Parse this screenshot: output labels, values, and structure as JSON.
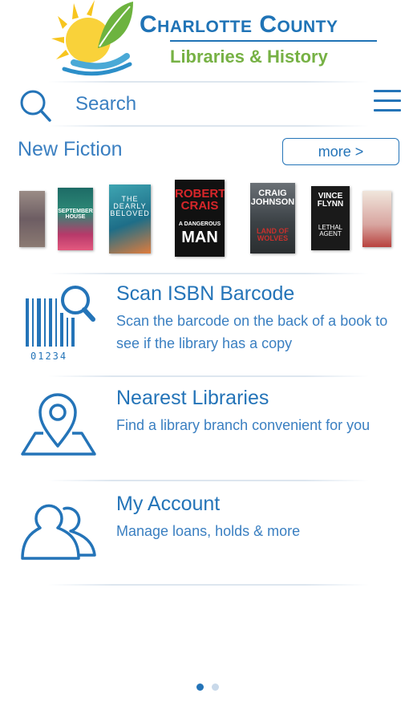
{
  "brand": {
    "title": "Charlotte County",
    "subtitle": "Libraries & History",
    "colors": {
      "blue": "#1f73b6",
      "green": "#76b144",
      "sun": "#f7c51e"
    }
  },
  "search": {
    "placeholder": "Search",
    "icon": "search-icon"
  },
  "menu": {
    "icon": "hamburger-menu-icon"
  },
  "new_fiction": {
    "title": "New Fiction",
    "more_label": "more >",
    "covers": [
      {
        "name": "book-cover-1",
        "text": ""
      },
      {
        "name": "book-cover-2",
        "text": "THE SEPTEMBER HOUSE"
      },
      {
        "name": "book-cover-3",
        "text": "THE DEARLY BELOVED"
      },
      {
        "name": "book-cover-4",
        "text": "ROBERT CRAIS A DANGEROUS MAN"
      },
      {
        "name": "book-cover-5",
        "text": "CRAIG JOHNSON LAND OF WOLVES"
      },
      {
        "name": "book-cover-6",
        "text": "VINCE FLYNN LETHAL AGENT"
      },
      {
        "name": "book-cover-7",
        "text": ""
      }
    ]
  },
  "features": [
    {
      "title": "Scan ISBN Barcode",
      "desc": "Scan the barcode on the back of a book to see if the library has a copy",
      "icon": "barcode-scan-icon",
      "barcode_digits": "01234"
    },
    {
      "title": "Nearest Libraries",
      "desc": "Find a library branch convenient for you",
      "icon": "map-pin-icon"
    },
    {
      "title": "My Account",
      "desc": "Manage loans, holds & more",
      "icon": "users-icon"
    }
  ],
  "pagination": {
    "count": 2,
    "active": 1,
    "active_color": "#2474b8",
    "inactive_color": "#c9d9ea"
  }
}
